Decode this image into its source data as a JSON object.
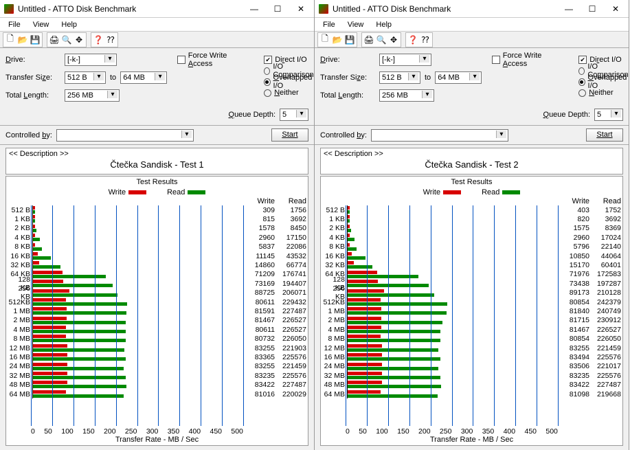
{
  "windows": [
    {
      "title": "Untitled - ATTO Disk Benchmark",
      "menu": [
        "File",
        "View",
        "Help"
      ],
      "drive_label": "Drive:",
      "transfer_size_label": "Transfer Size:",
      "total_length_label": "Total Length:",
      "to_label": "to",
      "drive": "[-k-]",
      "ts_from": "512 B",
      "ts_to": "64 MB",
      "total_length": "256 MB",
      "force_write": "Force Write Access",
      "direct_io": "Direct I/O",
      "io_comparison": "I/O Comparison",
      "overlapped_io": "Overlapped I/O",
      "neither": "Neither",
      "queue_depth_label": "Queue Depth:",
      "queue_depth": "5",
      "controlled_by_label": "Controlled by:",
      "controlled_by": "",
      "start": "Start",
      "desc_label": "<< Description >>",
      "desc_title": "Čtečka Sandisk - Test 1",
      "results_title": "Test Results",
      "legend_write": "Write",
      "legend_read": "Read",
      "col_write": "Write",
      "col_read": "Read",
      "axis_label": "Transfer Rate - MB / Sec"
    },
    {
      "title": "Untitled - ATTO Disk Benchmark",
      "menu": [
        "File",
        "View",
        "Help"
      ],
      "drive_label": "Drive:",
      "transfer_size_label": "Transfer Size:",
      "total_length_label": "Total Length:",
      "to_label": "to",
      "drive": "[-k-]",
      "ts_from": "512 B",
      "ts_to": "64 MB",
      "total_length": "256 MB",
      "force_write": "Force Write Access",
      "direct_io": "Direct I/O",
      "io_comparison": "I/O Comparison",
      "overlapped_io": "Overlapped I/O",
      "neither": "Neither",
      "queue_depth_label": "Queue Depth:",
      "queue_depth": "5",
      "controlled_by_label": "Controlled by:",
      "controlled_by": "",
      "start": "Start",
      "desc_label": "<< Description >>",
      "desc_title": "Čtečka Sandisk - Test 2",
      "results_title": "Test Results",
      "legend_write": "Write",
      "legend_read": "Read",
      "col_write": "Write",
      "col_read": "Read",
      "axis_label": "Transfer Rate - MB / Sec"
    }
  ],
  "axis_ticks": [
    "0",
    "50",
    "100",
    "150",
    "200",
    "250",
    "300",
    "350",
    "400",
    "450",
    "500"
  ],
  "chart_data": [
    {
      "type": "bar",
      "title": "Čtečka Sandisk - Test 1",
      "xlabel": "Transfer Rate - MB / Sec",
      "ylabel": "Transfer Size",
      "xlim": [
        0,
        500
      ],
      "categories": [
        "512 B",
        "1 KB",
        "2 KB",
        "4 KB",
        "8 KB",
        "16 KB",
        "32 KB",
        "64 KB",
        "128 KB",
        "256 KB",
        "512KB",
        "1 MB",
        "2 MB",
        "4 MB",
        "8 MB",
        "12 MB",
        "16 MB",
        "24 MB",
        "32 MB",
        "48 MB",
        "64 MB"
      ],
      "series": [
        {
          "name": "Write",
          "values_kb_per_sec": [
            309,
            815,
            1578,
            2960,
            5837,
            11145,
            14860,
            71209,
            73169,
            88725,
            80611,
            81591,
            81467,
            80611,
            80732,
            83255,
            83365,
            83255,
            83235,
            83422,
            81016
          ]
        },
        {
          "name": "Read",
          "values_kb_per_sec": [
            1756,
            3692,
            8450,
            17150,
            22086,
            43532,
            66774,
            176741,
            194407,
            206071,
            229432,
            227487,
            226527,
            226527,
            226050,
            221903,
            225576,
            221459,
            225576,
            227487,
            220029
          ]
        }
      ]
    },
    {
      "type": "bar",
      "title": "Čtečka Sandisk - Test 2",
      "xlabel": "Transfer Rate - MB / Sec",
      "ylabel": "Transfer Size",
      "xlim": [
        0,
        500
      ],
      "categories": [
        "512 B",
        "1 KB",
        "2 KB",
        "4 KB",
        "8 KB",
        "16 KB",
        "32 KB",
        "64 KB",
        "128 KB",
        "256 KB",
        "512KB",
        "1 MB",
        "2 MB",
        "4 MB",
        "8 MB",
        "12 MB",
        "16 MB",
        "24 MB",
        "32 MB",
        "48 MB",
        "64 MB"
      ],
      "series": [
        {
          "name": "Write",
          "values_kb_per_sec": [
            403,
            820,
            1575,
            2960,
            5796,
            10850,
            15170,
            71976,
            73438,
            89173,
            80854,
            81840,
            81715,
            81467,
            80854,
            83255,
            83494,
            83506,
            83235,
            83422,
            81098
          ]
        },
        {
          "name": "Read",
          "values_kb_per_sec": [
            1752,
            3692,
            8369,
            17024,
            22140,
            44064,
            60401,
            172583,
            197287,
            210128,
            242379,
            240749,
            230912,
            226527,
            226050,
            221459,
            225576,
            221017,
            225576,
            227487,
            219668
          ]
        }
      ]
    }
  ]
}
